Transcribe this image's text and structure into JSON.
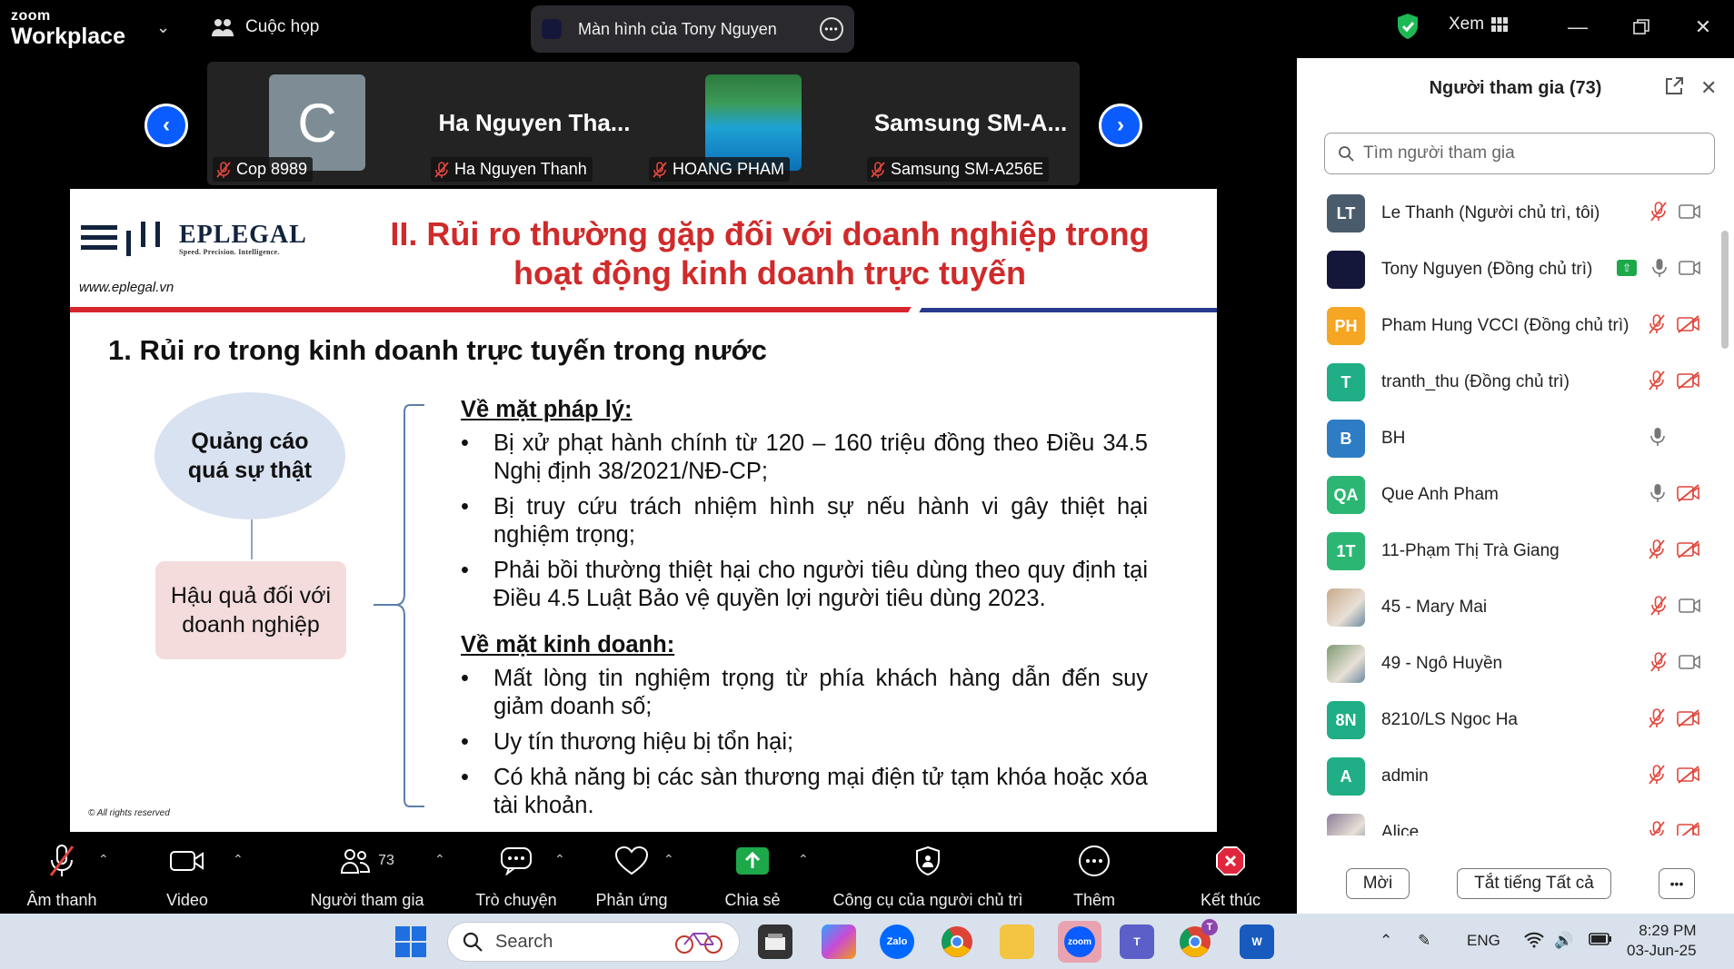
{
  "titlebar": {
    "brand_top": "zoom",
    "brand_bottom": "Workplace",
    "meeting_label": "Cuộc họp",
    "share_label": "Màn hình của Tony Nguyen",
    "view_label": "Xem"
  },
  "gallery": {
    "tiles": [
      {
        "initial": "C",
        "label": "Cop 8989"
      },
      {
        "big_name": "Ha  Nguyen  Tha...",
        "label": "Ha Nguyen Thanh"
      },
      {
        "label": "HOANG PHAM"
      },
      {
        "big_name": "Samsung  SM-A...",
        "label": "Samsung SM-A256E"
      }
    ]
  },
  "slide": {
    "logo": "EPLEGAL",
    "logo_tagline": "Speed. Precision. Intelligence.",
    "url": "www.eplegal.vn",
    "title_line1": "II. Rủi ro thường gặp đối với doanh nghiệp trong",
    "title_line2": "hoạt động kinh doanh trực tuyến",
    "section": "1. Rủi ro trong kinh doanh trực tuyến trong nước",
    "oval_line1": "Quảng cáo",
    "oval_line2": "quá sự thật",
    "box_line1": "Hậu quả đối với",
    "box_line2": "doanh nghiệp",
    "legal_heading": "Về mặt pháp lý:",
    "legal_items": [
      "Bị xử phạt hành chính từ 120 – 160 triệu đồng theo Điều 34.5 Nghị định 38/2021/NĐ-CP;",
      "Bị truy cứu trách nhiệm hình sự nếu hành vi gây thiệt hại nghiệm trọng;",
      "Phải bồi thường thiệt hại cho người tiêu dùng theo quy định tại Điều 4.5 Luật Bảo vệ quyền lợi người tiêu dùng 2023."
    ],
    "business_heading": "Về mặt kinh doanh:",
    "business_items": [
      "Mất lòng tin nghiệm trọng từ phía khách hàng dẫn đến suy giảm doanh số;",
      "Uy tín thương hiệu bị tổn hại;",
      "Có khả năng bị các sàn thương mại điện tử tạm khóa hoặc xóa tài khoản."
    ],
    "copyright": "© All rights reserved"
  },
  "panel": {
    "title": "Người tham gia (73)",
    "search_placeholder": "Tìm người tham gia",
    "participants": [
      {
        "initials": "LT",
        "color": "#4a5b6b",
        "name": "Le Thanh (Người chủ trì, tôi)",
        "mic": "muted",
        "cam": "on"
      },
      {
        "initials": "",
        "color": "#15173a",
        "name": "Tony Nguyen (Đồng chủ trì)",
        "mic": "on",
        "cam": "on",
        "sharing": true
      },
      {
        "initials": "PH",
        "color": "#f5a623",
        "name": "Pham Hung VCCI (Đồng chủ trì)",
        "mic": "muted",
        "cam": "off"
      },
      {
        "initials": "T",
        "color": "#1fae85",
        "name": "tranth_thu (Đồng chủ trì)",
        "mic": "muted",
        "cam": "off"
      },
      {
        "initials": "B",
        "color": "#2d7cc4",
        "name": "BH",
        "mic": "on",
        "cam": "none"
      },
      {
        "initials": "QA",
        "color": "#2bb673",
        "name": "Que Anh Pham",
        "mic": "on",
        "cam": "off"
      },
      {
        "initials": "1T",
        "color": "#2bb673",
        "name": "11-Phạm Thị Trà Giang",
        "mic": "muted",
        "cam": "off"
      },
      {
        "initials": "",
        "color": "#c9a98a",
        "name": "45 - Mary Mai",
        "mic": "muted",
        "cam": "on",
        "photo": true
      },
      {
        "initials": "",
        "color": "#7d9a73",
        "name": "49 - Ngô Huyền",
        "mic": "muted",
        "cam": "on",
        "photo": true
      },
      {
        "initials": "8N",
        "color": "#1fae85",
        "name": "8210/LS Ngoc Ha",
        "mic": "muted",
        "cam": "off"
      },
      {
        "initials": "A",
        "color": "#1fae85",
        "name": "admin",
        "mic": "muted",
        "cam": "off"
      },
      {
        "initials": "",
        "color": "#8c7d9a",
        "name": "Alice",
        "mic": "muted",
        "cam": "off",
        "photo": true
      }
    ],
    "invite_label": "Mời",
    "mute_all_label": "Tắt tiếng Tất cả"
  },
  "toolbar": {
    "audio": "Âm thanh",
    "video": "Video",
    "participants": "Người tham gia",
    "participants_count": "73",
    "chat": "Trò chuyện",
    "reactions": "Phản ứng",
    "share": "Chia sẻ",
    "host_tools": "Công cụ của người chủ trì",
    "more": "Thêm",
    "end": "Kết thúc"
  },
  "taskbar": {
    "search_placeholder": "Search",
    "language": "ENG",
    "time": "8:29 PM",
    "date": "03-Jun-25",
    "teams_badge": "T"
  },
  "colors": {
    "zoom_blue": "#0b5cff",
    "slide_title_red": "#d02a2a",
    "muted_red": "#e0463c",
    "share_green": "#1da84a"
  }
}
